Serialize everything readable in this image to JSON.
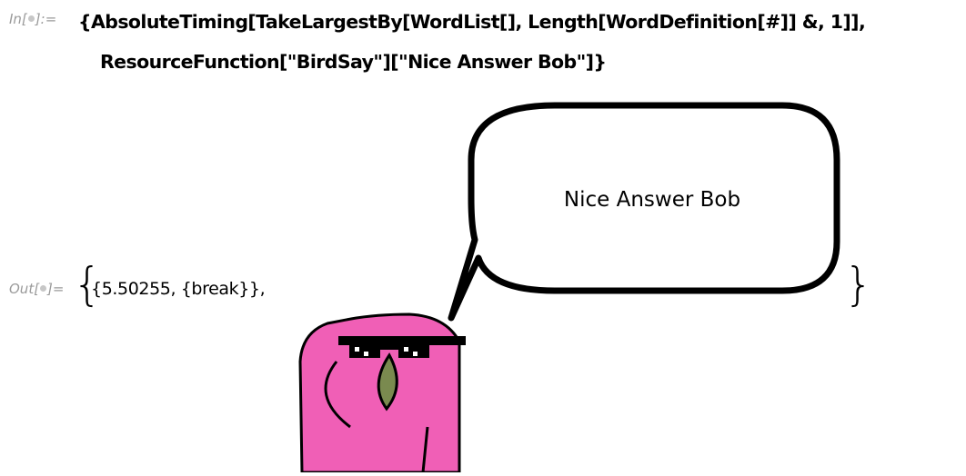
{
  "input_cell": {
    "label_prefix": "In[",
    "label_suffix": "]:=",
    "line1": "{AbsoluteTiming[TakeLargestBy[WordList[], Length[WordDefinition[#]] &, 1]],",
    "line2": "ResourceFunction[\"BirdSay\"][\"Nice Answer Bob\"]}"
  },
  "output_cell": {
    "label_prefix": "Out[",
    "label_suffix": "]=",
    "open_brace": "{",
    "close_brace": "}",
    "result_text": "{5.50255, {break}},",
    "bird": {
      "speech": "Nice Answer Bob",
      "body_color": "#f05fb6",
      "beak_color": "#7a8a4f",
      "sunglasses_color": "#000000"
    }
  }
}
